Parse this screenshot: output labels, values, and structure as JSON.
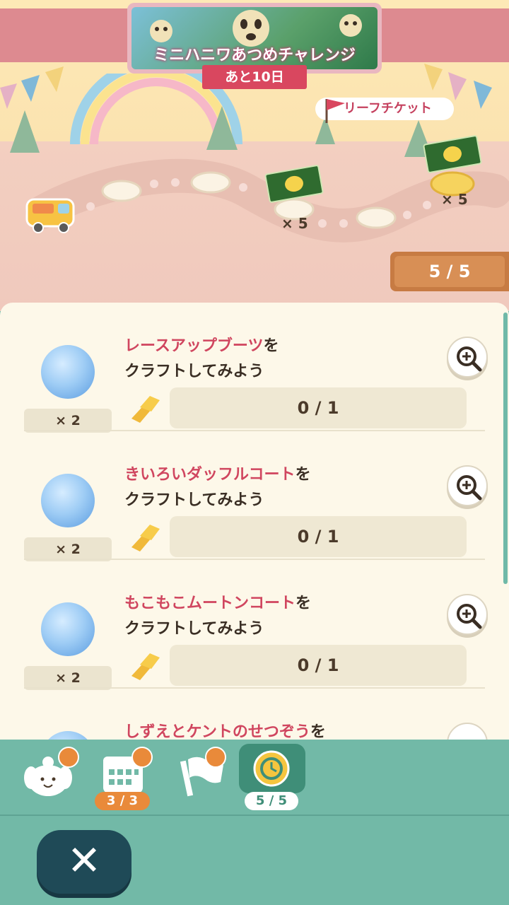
{
  "event": {
    "title": "ミニハニワあつめチャレンジ",
    "days_left": "あと10日",
    "reward_label": "リーフチケット"
  },
  "map": {
    "reward_qty_1": "× 5",
    "reward_qty_2": "× 5",
    "progress": "5 / 5"
  },
  "tasks": [
    {
      "highlight": "レースアップブーツ",
      "suffix": "を",
      "line2": "クラフトしてみよう",
      "reward_qty": "× 2",
      "progress": "0 / 1"
    },
    {
      "highlight": "きいろいダッフルコート",
      "suffix": "を",
      "line2": "クラフトしてみよう",
      "reward_qty": "× 2",
      "progress": "0 / 1"
    },
    {
      "highlight": "もこもこムートンコート",
      "suffix": "を",
      "line2": "クラフトしてみよう",
      "reward_qty": "× 2",
      "progress": "0 / 1"
    },
    {
      "highlight": "しずえとケントのせつぞう",
      "suffix": "を"
    }
  ],
  "tabs": [
    {
      "icon": "isabelle-icon"
    },
    {
      "icon": "calendar-icon",
      "count": "3 / 3"
    },
    {
      "icon": "flag-icon"
    },
    {
      "icon": "timer-icon",
      "count": "5 / 5"
    }
  ],
  "colors": {
    "accent": "#d0465f",
    "tabbar": "#72b9a7",
    "panel": "#fdf8e9"
  }
}
